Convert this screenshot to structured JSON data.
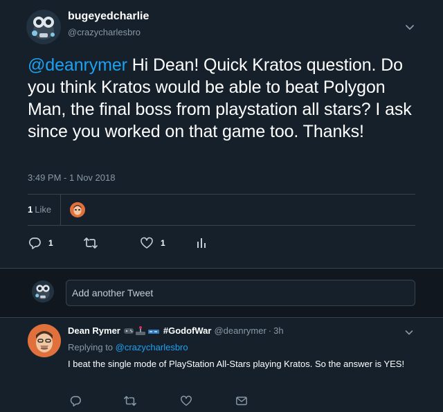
{
  "main_tweet": {
    "display_name": "bugeyedcharlie",
    "handle": "@crazycharlesbro",
    "mention": "@deanrymer",
    "text": " Hi Dean! Quick Kratos question. Do you think Kratos would be able to beat Polygon Man, the final boss from playstation all stars? I ask since you worked on that game too. Thanks!",
    "timestamp": "3:49 PM - 1 Nov 2018",
    "likes_count": "1",
    "likes_label": "Like",
    "reply_count": "1",
    "like_count_action": "1"
  },
  "composer": {
    "placeholder": "Add another Tweet"
  },
  "reply_tweet": {
    "display_name": "Dean Rymer",
    "hashtag": "#GodofWar",
    "handle": "@deanrymer",
    "dot": "·",
    "time": "3h",
    "replying_prefix": "Replying to ",
    "replying_handle": "@crazycharlesbro",
    "text": "I beat the single mode of PlayStation All-Stars playing Kratos. So the answer is YES!"
  },
  "colors": {
    "background": "#15202b",
    "accent": "#1da1f2",
    "secondary_text": "#8899a6",
    "border": "#38444d"
  },
  "icons": [
    "chevron-down-icon",
    "reply-icon",
    "retweet-icon",
    "like-icon",
    "analytics-icon",
    "message-icon"
  ]
}
